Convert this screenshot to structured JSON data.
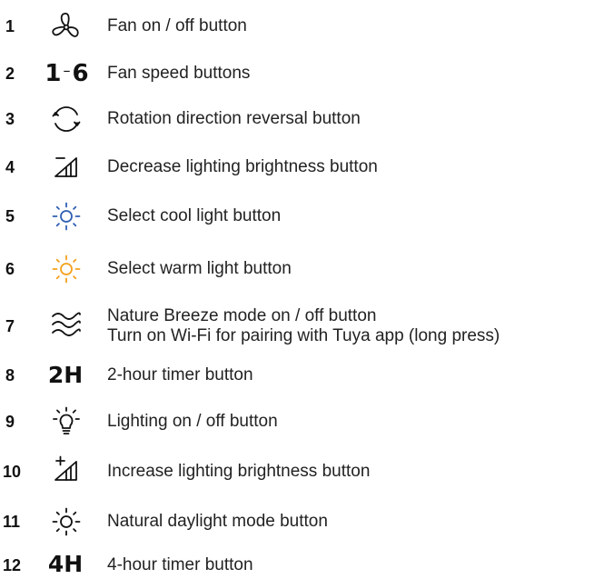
{
  "colors": {
    "text": "#222222",
    "number": "#111111",
    "cool_light": "#2f5fb3",
    "warm_light": "#f5a11c"
  },
  "items": [
    {
      "number": "1",
      "icon": "fan-icon",
      "label": "Fan on / off button"
    },
    {
      "number": "2",
      "icon": "fan-speed-icon",
      "icon_text_start": "1",
      "icon_text_end": "6",
      "label": "Fan speed buttons"
    },
    {
      "number": "3",
      "icon": "rotation-reverse-icon",
      "label": "Rotation direction reversal button"
    },
    {
      "number": "4",
      "icon": "brightness-decrease-icon",
      "label": "Decrease lighting brightness button"
    },
    {
      "number": "5",
      "icon": "cool-light-icon",
      "label": "Select cool light button"
    },
    {
      "number": "6",
      "icon": "warm-light-icon",
      "label": "Select warm light button"
    },
    {
      "number": "7",
      "icon": "nature-breeze-icon",
      "label": "Nature Breeze mode on / off button",
      "label_line2": "Turn on Wi-Fi for pairing with Tuya app (long press)"
    },
    {
      "number": "8",
      "icon": "timer-2h-icon",
      "icon_text": "2H",
      "label": "2-hour timer button"
    },
    {
      "number": "9",
      "icon": "light-bulb-icon",
      "label": "Lighting on / off button"
    },
    {
      "number": "10",
      "icon": "brightness-increase-icon",
      "label": "Increase lighting brightness button"
    },
    {
      "number": "11",
      "icon": "daylight-icon",
      "label": "Natural daylight mode button"
    },
    {
      "number": "12",
      "icon": "timer-4h-icon",
      "icon_text": "4H",
      "label": "4-hour timer button"
    }
  ]
}
